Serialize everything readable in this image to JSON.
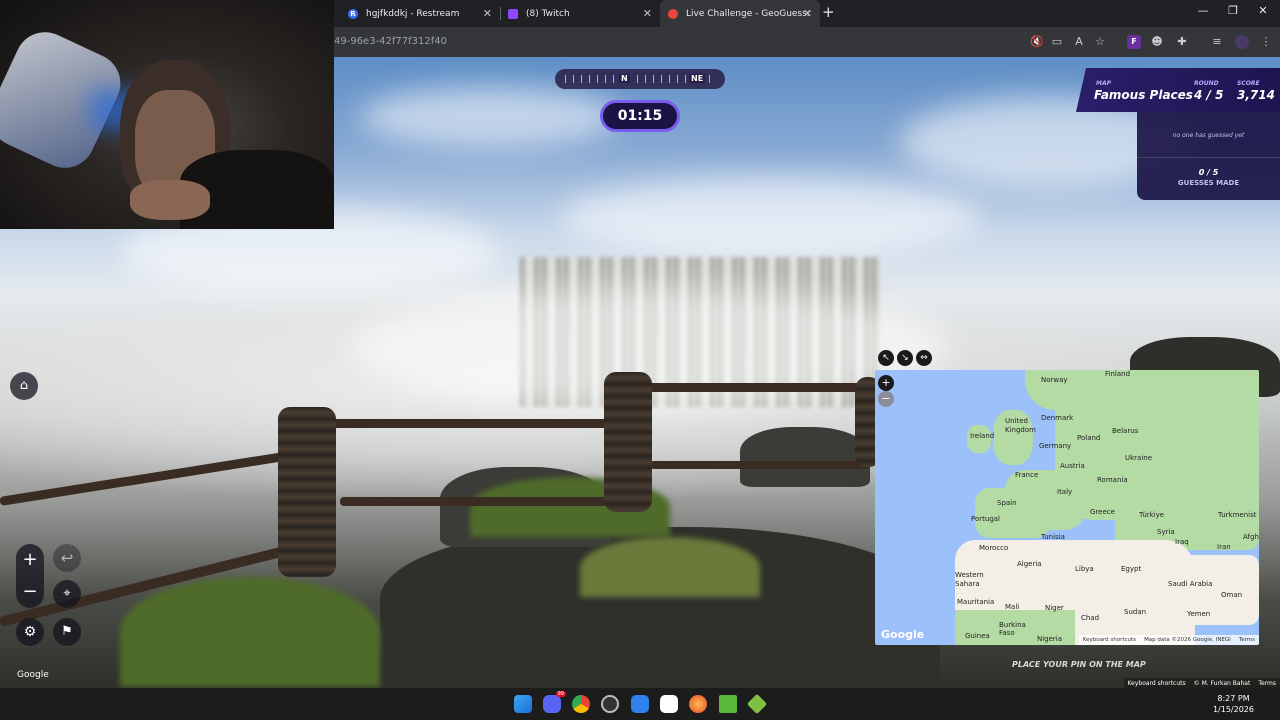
{
  "browser": {
    "tabs": [
      {
        "title": "hgjfkddkj - Restream",
        "icon": "restream-icon"
      },
      {
        "title": "(8) Twitch",
        "icon": "twitch-icon"
      },
      {
        "title": "Live Challenge - GeoGuessr",
        "icon": "geoguessr-pin-icon"
      }
    ],
    "url_fragment": "49-96e3-42f77f312f40"
  },
  "hud": {
    "compass": {
      "n": "N",
      "ne": "NE"
    },
    "timer": "01:15",
    "map_label": "MAP",
    "map_name": "Famous Places",
    "round_label": "ROUND",
    "round_value": "4 / 5",
    "score_label": "SCORE",
    "score_value": "3,714",
    "no_guesses": "no one has guessed yet",
    "guesses_count": "0 / 5",
    "guesses_label": "GUESSES MADE",
    "place_pin": "PLACE YOUR PIN ON THE MAP"
  },
  "map": {
    "labels": [
      "Norway",
      "Finland",
      "Denmark",
      "United Kingdom",
      "Ireland",
      "Belarus",
      "Poland",
      "Germany",
      "Ukraine",
      "Austria",
      "France",
      "Romania",
      "Italy",
      "Spain",
      "Portugal",
      "Greece",
      "Türkiye",
      "Turkmenist",
      "Tunisia",
      "Syria",
      "Iraq",
      "Iran",
      "Afgh",
      "Morocco",
      "Algeria",
      "Libya",
      "Egypt",
      "Western Sahara",
      "Saudi Arabia",
      "Oman",
      "Mauritania",
      "Mali",
      "Niger",
      "Chad",
      "Sudan",
      "Yemen",
      "Burkina Faso",
      "Guinea",
      "Nigeria"
    ],
    "google": "Google",
    "footer": [
      "Keyboard shortcuts",
      "Map data ©2026 Google, INEGI",
      "Terms"
    ]
  },
  "streetview": {
    "google": "Google",
    "footer": [
      "Keyboard shortcuts",
      "© M. Furkan Bahat",
      "Terms"
    ]
  },
  "taskbar": {
    "time": "8:27 PM",
    "date": "1/15/2026",
    "discord_badge": "99"
  }
}
